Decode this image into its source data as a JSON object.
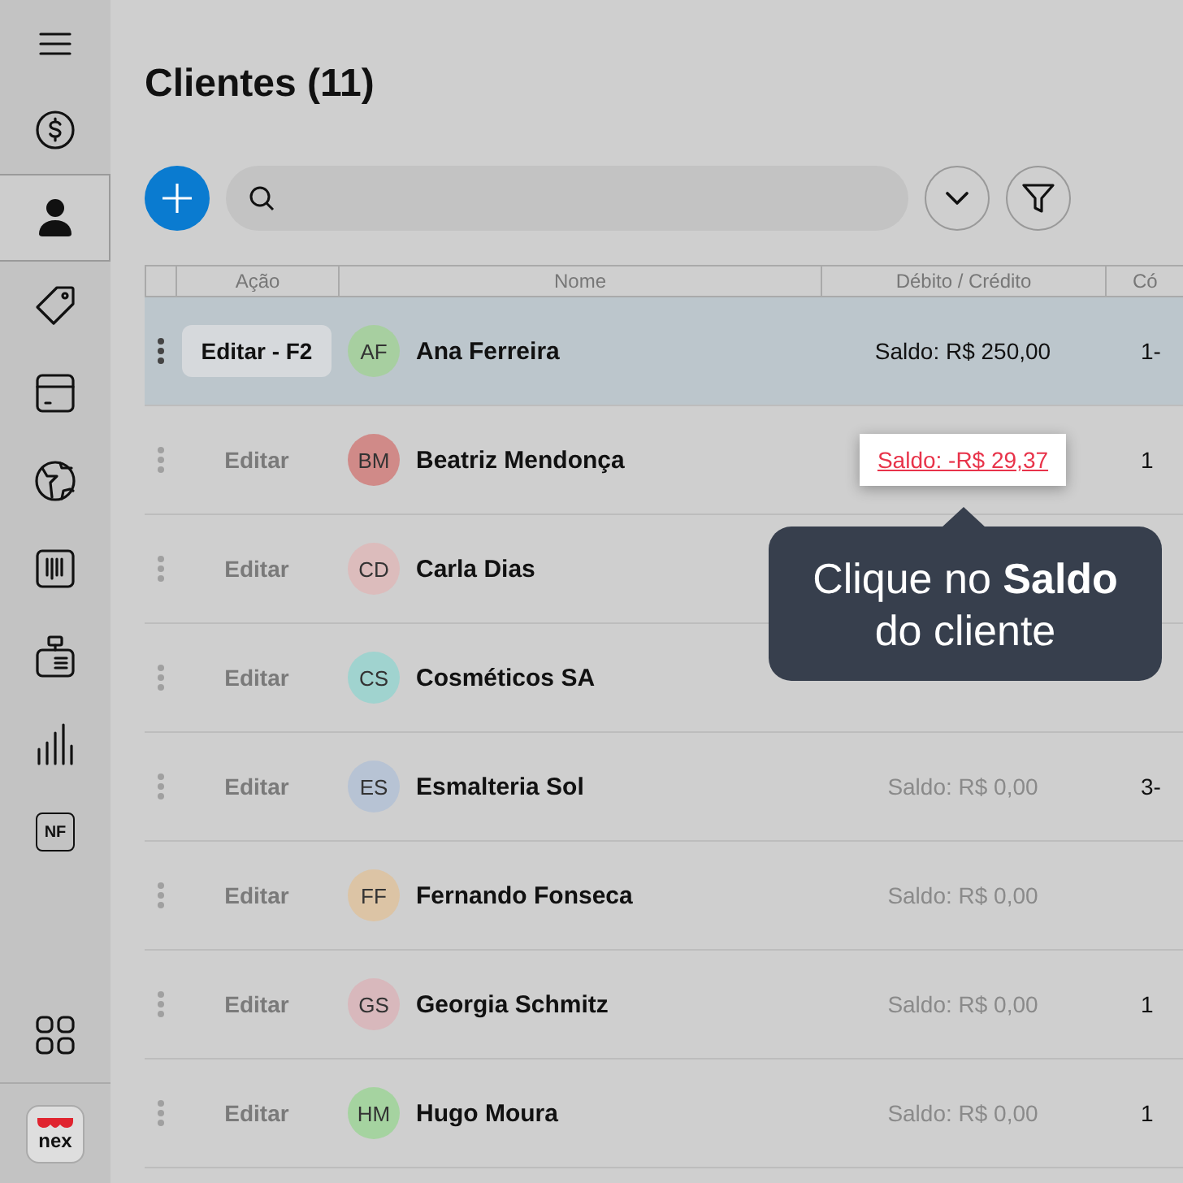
{
  "sidebar": {
    "items": [
      {
        "kind": "menu",
        "selected": false
      },
      {
        "kind": "dollar",
        "selected": false
      },
      {
        "kind": "person",
        "selected": true
      },
      {
        "kind": "tag",
        "selected": false
      },
      {
        "kind": "box",
        "selected": false
      },
      {
        "kind": "globe",
        "selected": false
      },
      {
        "kind": "barcode",
        "selected": false
      },
      {
        "kind": "register",
        "selected": false
      },
      {
        "kind": "chart",
        "selected": false
      },
      {
        "kind": "badge",
        "label": "NF",
        "selected": false
      }
    ],
    "apps": {
      "kind": "apps"
    },
    "logo": {
      "text": "nex"
    }
  },
  "title": "Clientes (11)",
  "table": {
    "columns": [
      "Ação",
      "Nome",
      "Débito / Crédito",
      "Có"
    ],
    "rows": [
      {
        "action": "Editar - F2",
        "initials": "AF",
        "color": "#a7cfa0",
        "name": "Ana Ferreira",
        "balance": {
          "text": "Saldo: R$ 250,00",
          "kind": "positive"
        },
        "column_4": "1-",
        "selected": true,
        "highlighted": false
      },
      {
        "action": "Editar",
        "initials": "BM",
        "color": "#d08a88",
        "name": "Beatriz Mendonça",
        "balance": {
          "text": "Saldo: -R$ 29,37",
          "kind": "negative"
        },
        "column_4": "1",
        "selected": false,
        "highlighted": true
      },
      {
        "action": "Editar",
        "initials": "CD",
        "color": "#dcbcbc",
        "name": "Carla Dias",
        "selected": false
      },
      {
        "action": "Editar",
        "initials": "CS",
        "color": "#a0d3cf",
        "name": "Cosméticos SA",
        "selected": false
      },
      {
        "action": "Editar",
        "initials": "ES",
        "color": "#b7c3d4",
        "name": "Esmalteria Sol",
        "balance": {
          "text": "Saldo: R$ 0,00",
          "kind": "zero"
        },
        "column_4": "3-",
        "selected": false,
        "highlighted": false
      },
      {
        "action": "Editar",
        "initials": "FF",
        "color": "#dcc4a5",
        "name": "Fernando Fonseca",
        "balance": {
          "text": "Saldo: R$ 0,00",
          "kind": "zero"
        },
        "selected": false,
        "highlighted": false
      },
      {
        "action": "Editar",
        "initials": "GS",
        "color": "#d8b8bc",
        "name": "Georgia Schmitz",
        "balance": {
          "text": "Saldo: R$ 0,00",
          "kind": "zero"
        },
        "column_4": "1",
        "selected": false,
        "highlighted": false
      },
      {
        "action": "Editar",
        "initials": "HM",
        "color": "#a5d3a0",
        "name": "Hugo Moura",
        "balance": {
          "text": "Saldo: R$ 0,00",
          "kind": "zero"
        },
        "column_4": "1",
        "selected": false,
        "highlighted": false
      }
    ]
  },
  "tooltip": {
    "text": "Clique no **Saldo** do cliente"
  }
}
